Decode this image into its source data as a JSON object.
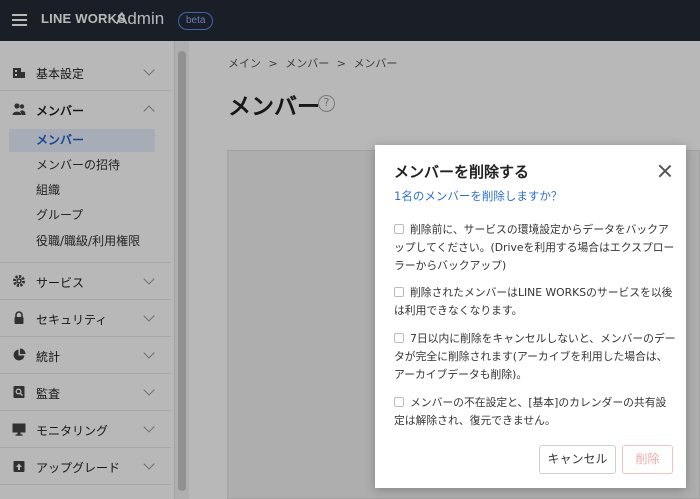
{
  "header": {
    "brand": "LINE WORKS",
    "product": "Admin",
    "badge": "beta"
  },
  "sidebar": {
    "sections": [
      {
        "label": "基本設定",
        "icon": "building-icon",
        "open": false
      },
      {
        "label": "メンバー",
        "icon": "members-icon",
        "open": true,
        "items": [
          {
            "label": "メンバー",
            "active": true
          },
          {
            "label": "メンバーの招待",
            "active": false
          },
          {
            "label": "組織",
            "active": false
          },
          {
            "label": "グループ",
            "active": false
          },
          {
            "label": "役職/職級/利用権限",
            "active": false
          }
        ]
      },
      {
        "label": "サービス",
        "icon": "gear-icon",
        "open": false
      },
      {
        "label": "セキュリティ",
        "icon": "lock-icon",
        "open": false
      },
      {
        "label": "統計",
        "icon": "pie-chart-icon",
        "open": false
      },
      {
        "label": "監査",
        "icon": "audit-icon",
        "open": false
      },
      {
        "label": "モニタリング",
        "icon": "monitor-icon",
        "open": false
      },
      {
        "label": "アップグレード",
        "icon": "upgrade-icon",
        "open": false
      }
    ]
  },
  "breadcrumb": [
    "メイン",
    "メンバー",
    "メンバー"
  ],
  "breadcrumb_separator": ">",
  "page": {
    "title": "メンバー",
    "help": "?"
  },
  "modal": {
    "title": "メンバーを削除する",
    "question": "1名のメンバーを削除しますか？",
    "checks": [
      "削除前に、サービスの環境設定からデータをバックアップしてください。(Driveを利用する場合はエクスプローラーからバックアップ)",
      "削除されたメンバーはLINE WORKSのサービスを以後は利用できなくなります。",
      "7日以内に削除をキャンセルしないと、メンバーのデータが完全に削除されます(アーカイブを利用した場合は、アーカイブデータも削除)。",
      "メンバーの不在設定と、[基本]のカレンダーの共有設定は解除され、復元できません。"
    ],
    "cancel_label": "キャンセル",
    "delete_label": "削除"
  },
  "colors": {
    "topbar": "#232a36",
    "accent": "#2c6fd3",
    "active_bg": "#e8f0fc",
    "delete_disabled": "#f1a8a8"
  }
}
